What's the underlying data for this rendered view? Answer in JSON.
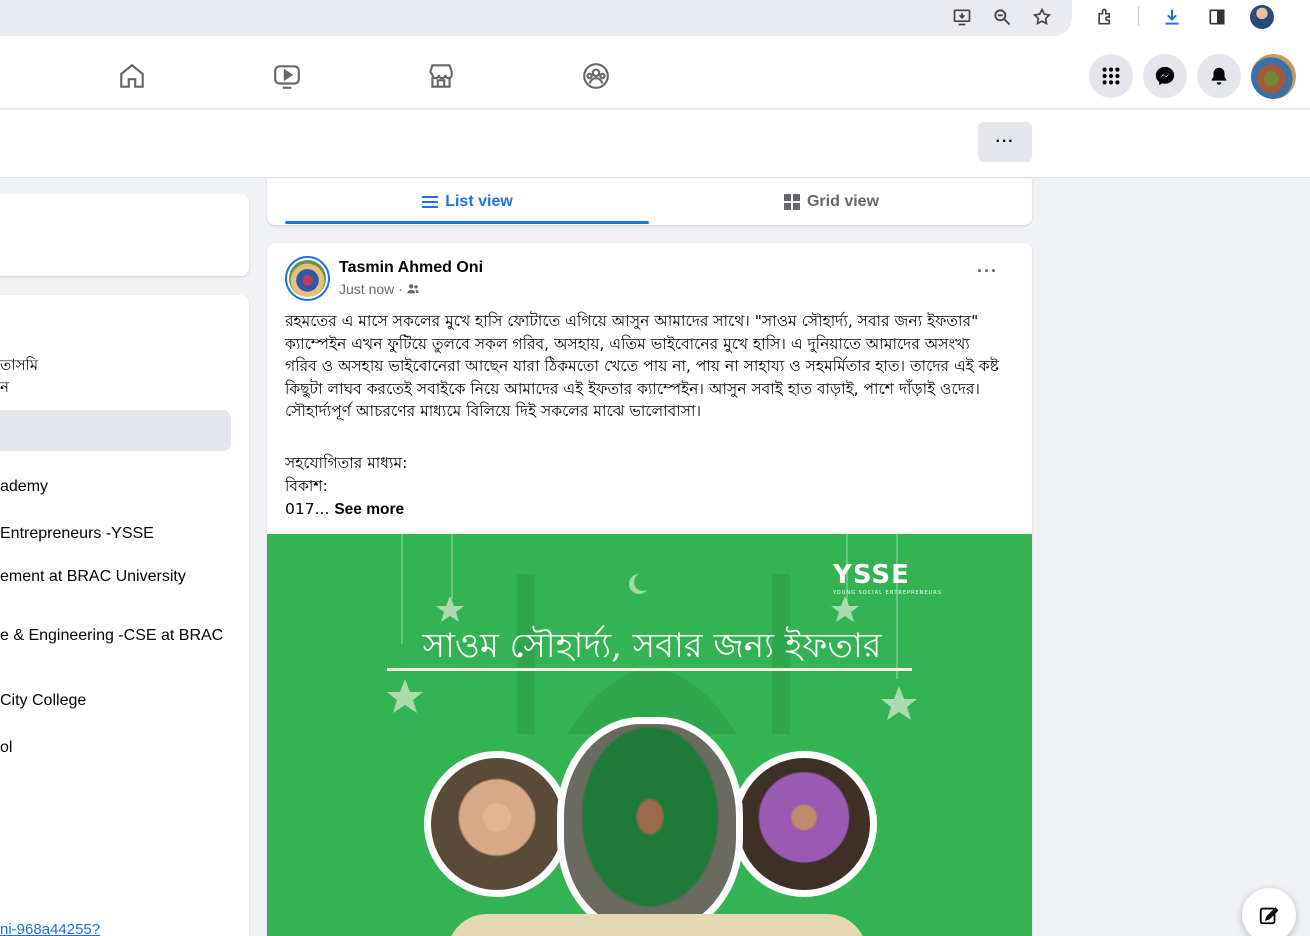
{
  "browser": {
    "icons": [
      "install-app-icon",
      "zoom-icon",
      "star-icon",
      "extensions-icon",
      "download-icon",
      "side-panel-icon",
      "profile-avatar"
    ]
  },
  "nav": {
    "tabs": [
      "home-icon",
      "video-icon",
      "marketplace-icon",
      "groups-icon"
    ],
    "right_buttons": [
      "menu-grid-icon",
      "messenger-icon",
      "notifications-icon"
    ]
  },
  "profile_header": {
    "more_label": "···"
  },
  "left_sidebar": {
    "intro_lines": [
      "তাসমি",
      "ন"
    ],
    "items": [
      "ademy",
      "Entrepreneurs -YSSE",
      "ement at BRAC University",
      "e & Engineering -CSE at BRAC",
      "City College",
      "ol"
    ],
    "link": "ni-968a44255?"
  },
  "view_switch": {
    "list_label": "List view",
    "grid_label": "Grid view"
  },
  "post": {
    "author": "Tasmin Ahmed Oni",
    "time": "Just now ·",
    "more_label": "···",
    "body": "রহমতের এ মাসে সকলের মুখে হাসি ফোটাতে এগিয়ে আসুন আমাদের সাথে। \"সাওম সৌহার্দ্য, সবার জন্য ইফতার\" ক্যাম্পেইন এখন ফুটিয়ে তুলবে সকল গরিব, অসহায়, এতিম ভাইবোনের মুখে হাসি। এ দুনিয়াতে আমাদের অসংখ্য গরিব ও অসহায় ভাইবোনেরা আছেন যারা ঠিকমতো খেতে পায় না, পায় না সাহায্য ও সহমর্মিতার হাত। তাদের এই কষ্ট কিছুটা লাঘব করতেই সবাইকে নিয়ে আমাদের এই ইফতার ক্যাম্পেইন। আসুন সবাই হাত বাড়াই, পাশে দাঁড়াই ওদের। সৌহার্দ্যপূর্ণ আচরণের মাধ্যমে বিলিয়ে দিই সকলের মাঝে ভালোবাসা।",
    "line1": "সহযোগিতার মাধ্যম:",
    "line2": "বিকাশ:",
    "line3": "017...",
    "see_more": "See more"
  },
  "banner": {
    "logo": "YSSE",
    "logo_tagline": "YOUNG SOCIAL ENTREPRENEURS",
    "title": "সাওম সৌহার্দ্য, সবার জন্য ইফতার",
    "background_color": "#34b353"
  },
  "colors": {
    "accent": "#1b74e4",
    "page_bg": "#f0f2f5",
    "link": "#216fdb"
  }
}
